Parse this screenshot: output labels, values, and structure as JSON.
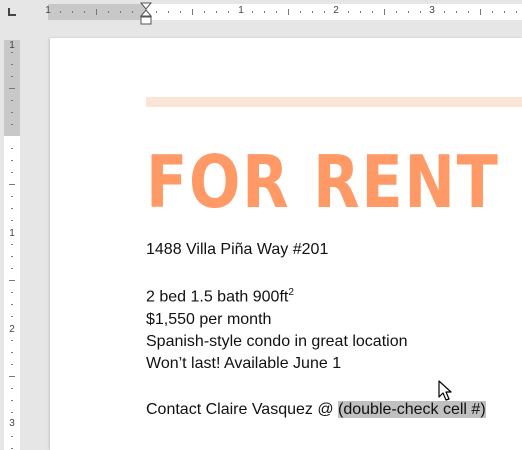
{
  "ruler": {
    "horizontal_numbers": [
      "1",
      "1",
      "2",
      "3"
    ],
    "vertical_numbers": [
      "1",
      "1",
      "2",
      "3"
    ]
  },
  "document": {
    "banner_color": "#fbe5d6",
    "headline": "FOR RENT",
    "headline_color": "#ff9966",
    "address": "1488 Villa Piña Way #201",
    "specs_prefix": "2 bed 1.5 bath 900ft",
    "specs_superscript": "2",
    "price": "$1,550 per month",
    "description": "Spanish-style condo in great location",
    "availability": "Won’t last! Available June 1",
    "contact_prefix": "Contact Claire Vasquez @ ",
    "contact_selected": "(double-check cell #)",
    "selection_color": "#c0c0c0"
  },
  "icons": {
    "tab_selector": "left-tab-icon",
    "indent": "indent-marker-icon",
    "pointer": "arrow-cursor-icon"
  }
}
